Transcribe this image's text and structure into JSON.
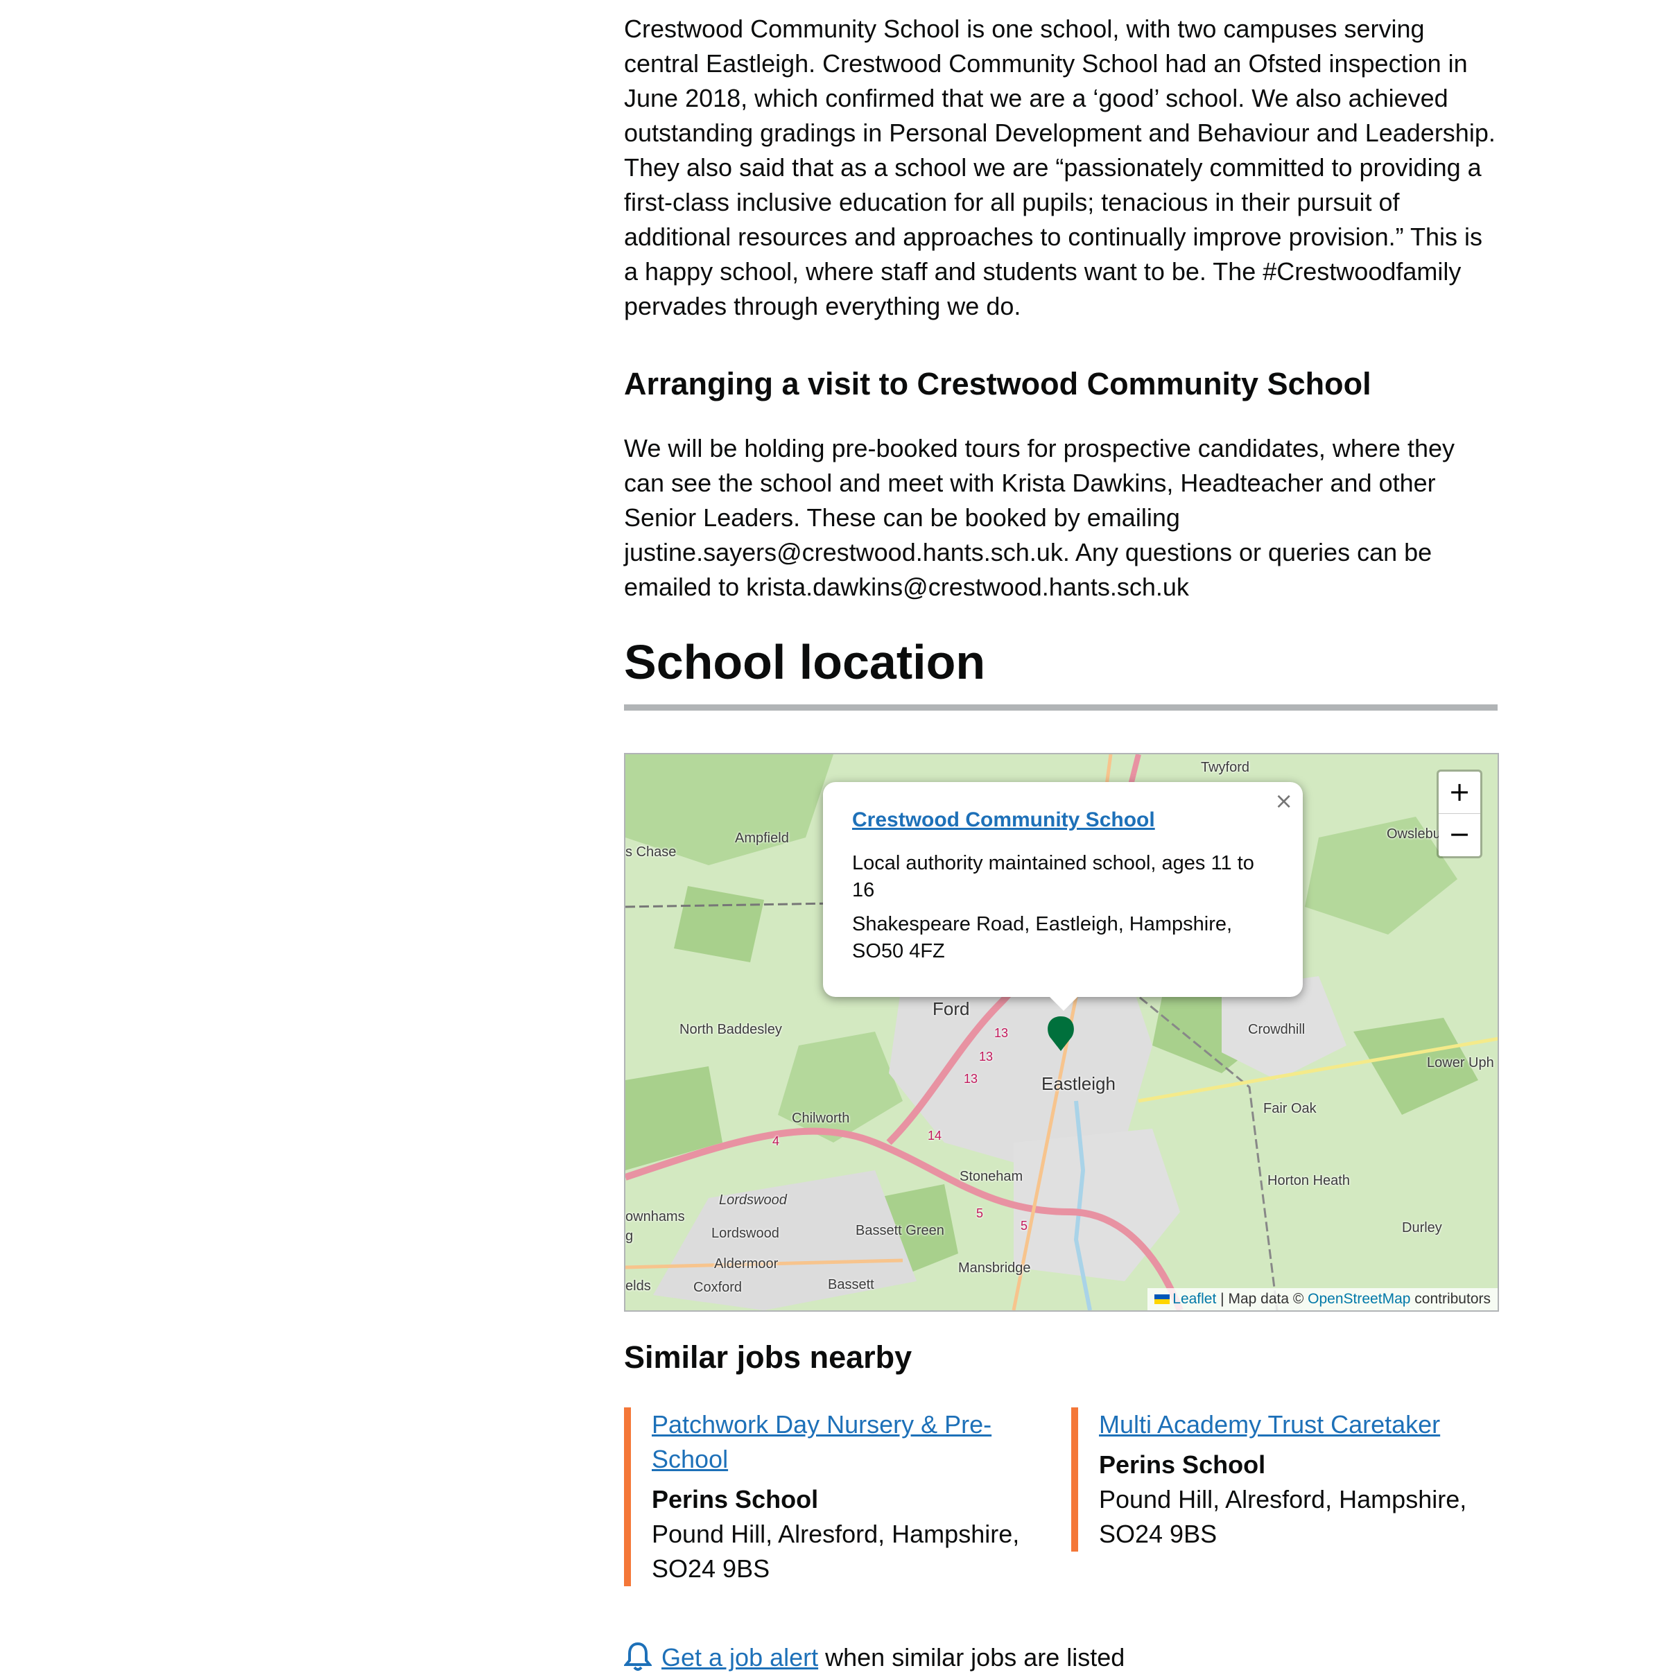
{
  "intro": "Crestwood Community School is one school, with two campuses serving central Eastleigh. Crestwood Community School had an Ofsted inspection in June 2018, which confirmed that we are a ‘good’ school. We also achieved outstanding gradings in Personal Development and Behaviour and Leadership. They also said that as a school we are “passionately committed to providing a first-class inclusive education for all pupils; tenacious in their pursuit of additional resources and approaches to continually improve provision.” This is a happy school, where staff and students want to be. The #Crestwoodfamily pervades through everything we do.",
  "visit": {
    "heading": "Arranging a visit to Crestwood Community School",
    "text": "We will be holding pre-booked tours for prospective candidates, where they can see the school and meet with Krista Dawkins, Headteacher and other Senior Leaders. These can be booked by emailing justine.sayers@crestwood.hants.sch.uk. Any questions or queries can be emailed to krista.dawkins@crestwood.hants.sch.uk"
  },
  "location": {
    "heading": "School location",
    "map": {
      "zoom_in": "+",
      "zoom_out": "−",
      "popup": {
        "close": "×",
        "school_name": "Crestwood Community School",
        "type": "Local authority maintained school, ages 11 to 16",
        "address": "Shakespeare Road, Eastleigh, Hampshire, SO50 4FZ"
      },
      "attribution": {
        "leaflet": "Leaflet",
        "separator": "| Map data ©",
        "osm": "OpenStreetMap",
        "suffix": "contributors"
      },
      "places": {
        "twyford": "Twyford",
        "ampfield": "Ampfield",
        "chase": "s Chase",
        "owslebury": "Owslebu",
        "ford": "Ford",
        "north_baddesley": "North Baddesley",
        "crowdhill": "Crowdhill",
        "lower_upham": "Lower Uph",
        "eastleigh": "Eastleigh",
        "fair_oak": "Fair Oak",
        "chilworth": "Chilworth",
        "stoneham": "Stoneham",
        "horton_heath": "Horton Heath",
        "lordswood_italic": "Lordswood",
        "ownhams": "ownhams",
        "durley": "Durley",
        "lordswood": "Lordswood",
        "bassett_green": "Bassett Green",
        "aldermoor": "Aldermoor",
        "mansbridge": "Mansbridge",
        "coxford": "Coxford",
        "bassett": "Bassett",
        "elds": "elds",
        "g": "g"
      },
      "road_numbers": {
        "r13a": "13",
        "r13b": "13",
        "r13c": "13",
        "r14": "14",
        "r4": "4",
        "r5a": "5",
        "r5b": "5"
      }
    }
  },
  "similar": {
    "heading": "Similar jobs nearby",
    "jobs": [
      {
        "title": "Patchwork Day Nursery & Pre-School",
        "org": "Perins School",
        "address": "Pound Hill, Alresford, Hampshire, SO24 9BS"
      },
      {
        "title": "Multi Academy Trust Caretaker",
        "org": "Perins School",
        "address": "Pound Hill, Alresford, Hampshire, SO24 9BS"
      }
    ]
  },
  "alert": {
    "link": "Get a job alert",
    "text": " when similar jobs are listed"
  },
  "colors": {
    "link": "#1d70b8",
    "accent": "#f47738",
    "marker": "#00703c",
    "rule": "#b1b4b6"
  }
}
